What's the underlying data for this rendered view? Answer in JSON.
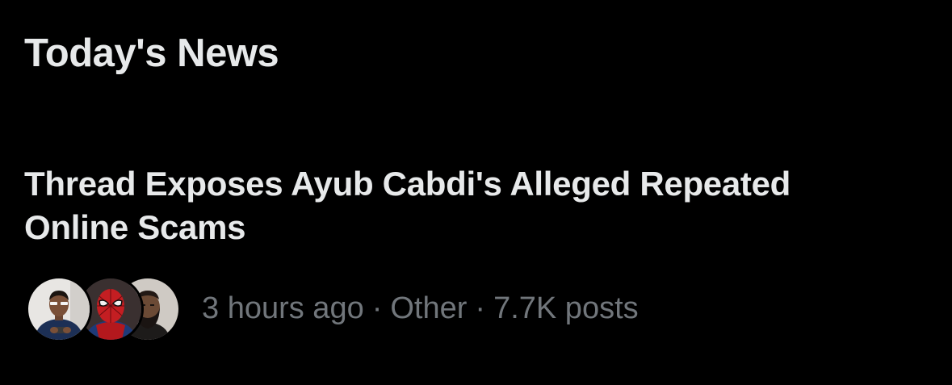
{
  "section": {
    "title": "Today's News"
  },
  "story": {
    "headline": "Thread Exposes Ayub Cabdi's Alleged Repeated Online Scams",
    "time": "3 hours ago",
    "separator": "·",
    "category": "Other",
    "posts": "7.7K posts"
  },
  "colors": {
    "background": "#000000",
    "primary_text": "#e7e9ea",
    "secondary_text": "#71767b"
  }
}
